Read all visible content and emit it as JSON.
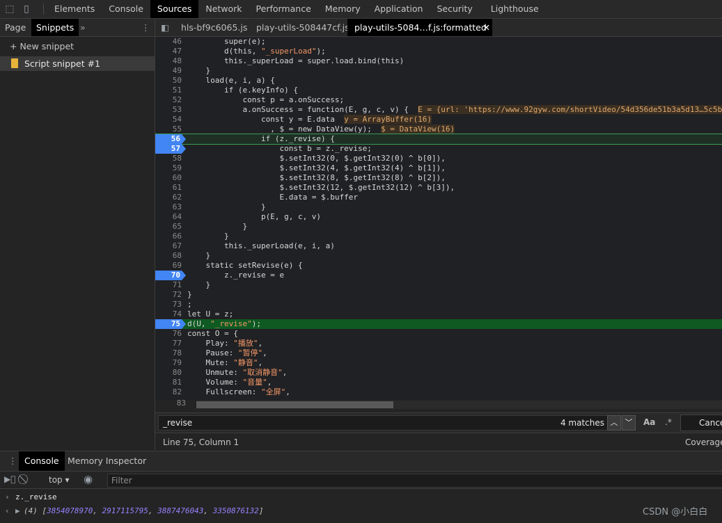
{
  "top_tabs": [
    "Elements",
    "Console",
    "Sources",
    "Network",
    "Performance",
    "Memory",
    "Application",
    "Security",
    "Lighthouse"
  ],
  "active_top_tab": "Sources",
  "navigator": {
    "tabs": [
      "Page",
      "Snippets"
    ],
    "more": "»",
    "new_snippet": "New snippet",
    "snippet": "Script snippet #1"
  },
  "editor_tabs": [
    "hls-bf9c6065.js",
    "play-utils-508447cf.js",
    "play-utils-5084…f.js:formatted"
  ],
  "code": {
    "l46": "        super(e);",
    "l47a": "        d(this, ",
    "l47b": "\"_superLoad\"",
    "l47c": ");",
    "l48": "        this._superLoad = super.load.bind(this)",
    "l49": "    }",
    "l50": "    load(e, i, a) {",
    "l51": "        if (e.keyInfo) {",
    "l52": "            const p = a.onSuccess;",
    "l53": "            a.onSuccess = function(E, g, c, v) {  ",
    "l53eval": "E = {url: 'https://www.92gyw.com/shortVideo/54d356de51b3a5d13…5c5b",
    "l54": "                const y = E.data  ",
    "l54eval": "y = ArrayBuffer(16)",
    "l55": "                  , $ = new DataView(y);  ",
    "l55eval": "$ = DataView(16)",
    "l56": "                if (z._revise) {",
    "l57": "                    const b = z._revise;",
    "l58": "                    $.setInt32(0, $.getInt32(0) ^ b[0]),",
    "l59": "                    $.setInt32(4, $.getInt32(4) ^ b[1]),",
    "l60": "                    $.setInt32(8, $.getInt32(8) ^ b[2]),",
    "l61": "                    $.setInt32(12, $.getInt32(12) ^ b[3]),",
    "l62": "                    E.data = $.buffer",
    "l63": "                }",
    "l64": "                p(E, g, c, v)",
    "l65": "            }",
    "l66": "        }",
    "l67": "        this._superLoad(e, i, a)",
    "l68": "    }",
    "l69": "    static setRevise(e) {",
    "l70": "        z._revise = e",
    "l71": "    }",
    "l72": "}",
    "l73": ";",
    "l74": "let U = z;",
    "l75a": "d(U, ",
    "l75b": "\"_revise\"",
    "l75c": ");",
    "l76": "const O = {",
    "l77a": "    Play: ",
    "l77b": "\"播放\"",
    "l78a": "    Pause: ",
    "l78b": "\"暂停\"",
    "l79a": "    Mute: ",
    "l79b": "\"静音\"",
    "l80a": "    Unmute: ",
    "l80b": "\"取消静音\"",
    "l81a": "    Volume: ",
    "l81b": "\"音量\"",
    "l82a": "    Fullscreen: ",
    "l82b": "\"全屏\"",
    "comma": ",",
    "l83": ""
  },
  "line_numbers": [
    "46",
    "47",
    "48",
    "49",
    "50",
    "51",
    "52",
    "53",
    "54",
    "55",
    "56",
    "57",
    "58",
    "59",
    "60",
    "61",
    "62",
    "63",
    "64",
    "65",
    "66",
    "67",
    "68",
    "69",
    "70",
    "71",
    "72",
    "73",
    "74",
    "75",
    "76",
    "77",
    "78",
    "79",
    "80",
    "81",
    "82",
    "83"
  ],
  "search": {
    "query": "_revise",
    "matches": "4 matches",
    "case_label": "Aa",
    "regex_label": ".*",
    "cancel": "Cancel"
  },
  "status": {
    "position": "Line 75, Column 1",
    "coverage": "Coverage: n/a"
  },
  "drawer": {
    "tabs": [
      "Console",
      "Memory Inspector"
    ],
    "context": "top",
    "filter_placeholder": "Filter"
  },
  "console": {
    "input": "z._revise",
    "output_count": "(4)",
    "values": [
      "3854078970",
      "2917115795",
      "3887476043",
      "3350876132"
    ]
  },
  "watermark": "CSDN @小白白"
}
